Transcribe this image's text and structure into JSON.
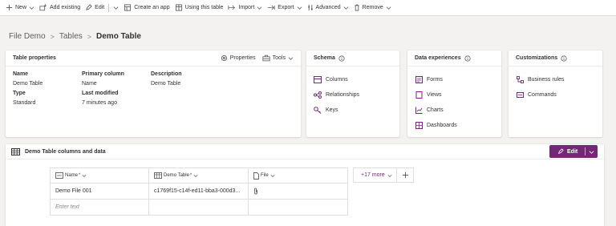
{
  "toolbar": {
    "new": "New",
    "add_existing": "Add existing",
    "edit": "Edit",
    "create_app": "Create an app",
    "using_table": "Using this table",
    "import": "Import",
    "export": "Export",
    "advanced": "Advanced",
    "remove": "Remove"
  },
  "breadcrumb": {
    "root": "File Demo",
    "tables": "Tables",
    "current": "Demo Table"
  },
  "table_properties": {
    "title": "Table properties",
    "properties_label": "Properties",
    "tools_label": "Tools",
    "name_label": "Name",
    "name_value": "Demo Table",
    "type_label": "Type",
    "type_value": "Standard",
    "primary_column_label": "Primary column",
    "primary_column_value": "Name",
    "last_modified_label": "Last modified",
    "last_modified_value": "7 minutes ago",
    "description_label": "Description",
    "description_value": "Demo Table"
  },
  "schema": {
    "title": "Schema",
    "items": [
      "Columns",
      "Relationships",
      "Keys"
    ]
  },
  "data_experiences": {
    "title": "Data experiences",
    "items": [
      "Forms",
      "Views",
      "Charts",
      "Dashboards"
    ]
  },
  "customizations": {
    "title": "Customizations",
    "items": [
      "Business rules",
      "Commands"
    ]
  },
  "data_panel": {
    "title": "Demo Table columns and data",
    "edit_label": "Edit",
    "columns": [
      {
        "label": "Name",
        "required": "*"
      },
      {
        "label": "Demo Table",
        "required": "*"
      },
      {
        "label": "File",
        "required": ""
      }
    ],
    "more_columns": "+17 more",
    "rows": [
      [
        "Demo File 001",
        "c1769f15-c14f-ed11-bba3-000d3...",
        ""
      ]
    ],
    "new_row_placeholder": "Enter text"
  },
  "colors": {
    "accent": "#742774",
    "link_purple": "#742774",
    "background": "#f3f2f1"
  },
  "icons": {
    "new": "plus-icon",
    "add_existing": "add-existing-icon",
    "edit": "pencil-icon",
    "create_app": "app-icon",
    "using_table": "table-icon",
    "import": "import-icon",
    "export": "export-icon",
    "advanced": "advanced-icon",
    "remove": "trash-icon"
  }
}
